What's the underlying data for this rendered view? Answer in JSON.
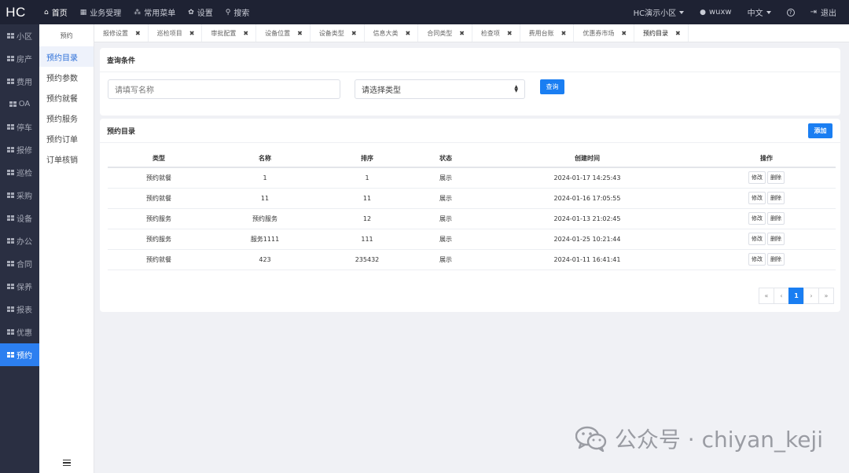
{
  "topbar": {
    "logo": "HC",
    "nav": [
      {
        "icon": "home-icon",
        "glyph": "⌂",
        "label": "首页"
      },
      {
        "icon": "table-icon",
        "glyph": "▦",
        "label": "业务受理"
      },
      {
        "icon": "sitemap-icon",
        "glyph": "⁂",
        "label": "常用菜单"
      },
      {
        "icon": "gear-icon",
        "glyph": "✿",
        "label": "设置"
      },
      {
        "icon": "search-icon",
        "glyph": "⚲",
        "label": "搜索"
      }
    ],
    "community": "HC演示小区",
    "user": "wuxw",
    "language": "中文",
    "help_glyph": "?",
    "logout": "退出"
  },
  "leftbar": {
    "items": [
      "小区",
      "房产",
      "费用",
      "OA",
      "停车",
      "报修",
      "巡检",
      "采购",
      "设备",
      "办公",
      "合同",
      "保养",
      "报表",
      "优惠",
      "预约"
    ],
    "active_index": 14
  },
  "subbar": {
    "title": "预约",
    "items": [
      "预约目录",
      "预约参数",
      "预约就餐",
      "预约服务",
      "预约订单",
      "订单核销"
    ],
    "active_index": 0
  },
  "tabs": [
    "报修设置",
    "巡检项目",
    "审批配置",
    "设备位置",
    "设备类型",
    "信息大类",
    "合同类型",
    "检查项",
    "费用台账",
    "优惠券市场",
    "预约目录"
  ],
  "active_tab": 10,
  "query": {
    "title": "查询条件",
    "name_placeholder": "请填写名称",
    "type_placeholder": "请选择类型",
    "button": "查询"
  },
  "catalog": {
    "title": "预约目录",
    "add_button": "添加",
    "columns": [
      "类型",
      "名称",
      "排序",
      "状态",
      "创建时间",
      "操作"
    ],
    "rows": [
      {
        "type": "预约就餐",
        "name": "1",
        "sort": "1",
        "status": "展示",
        "created": "2024-01-17 14:25:43"
      },
      {
        "type": "预约就餐",
        "name": "11",
        "sort": "11",
        "status": "展示",
        "created": "2024-01-16 17:05:55"
      },
      {
        "type": "预约服务",
        "name": "预约服务",
        "sort": "12",
        "status": "展示",
        "created": "2024-01-13 21:02:45"
      },
      {
        "type": "预约服务",
        "name": "服务1111",
        "sort": "111",
        "status": "展示",
        "created": "2024-01-25 10:21:44"
      },
      {
        "type": "预约就餐",
        "name": "423",
        "sort": "235432",
        "status": "展示",
        "created": "2024-01-11 16:41:41"
      }
    ],
    "edit_label": "修改",
    "delete_label": "删除"
  },
  "pager": {
    "first": "«",
    "prev": "‹",
    "current": "1",
    "next": "›",
    "last": "»"
  },
  "watermark": "公众号 · chiyan_keji",
  "colors": {
    "topbar": "#1e2233",
    "sidebar": "#2a2f42",
    "accent": "#1a7ef2"
  }
}
